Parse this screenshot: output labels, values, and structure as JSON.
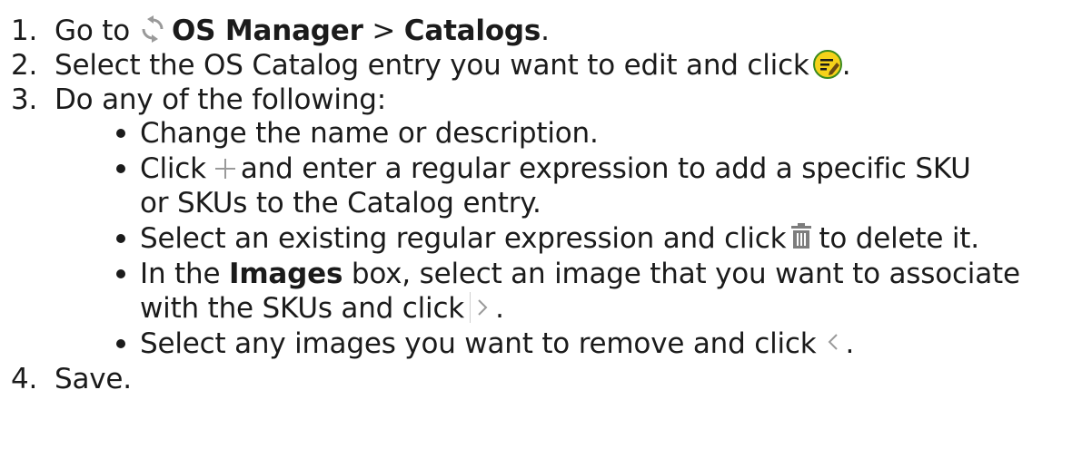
{
  "steps": [
    {
      "num": "1.",
      "pre": "Go to",
      "bold1": "OS Manager",
      "mid": ">",
      "bold2": "Catalogs",
      "end": "."
    },
    {
      "num": "2.",
      "text": "Select the OS Catalog entry you want to edit and click",
      "end": "."
    },
    {
      "num": "3.",
      "text": "Do any of the following:"
    },
    {
      "num": "4.",
      "text": "Save."
    }
  ],
  "bullets": [
    {
      "text": "Change the name or description."
    },
    {
      "pre": "Click",
      "post": "and enter a regular expression to add a specific SKU",
      "cont": "or SKUs to the Catalog entry."
    },
    {
      "pre": "Select an existing regular expression and click",
      "post": "to delete it."
    },
    {
      "pre": "In the",
      "bold": "Images",
      "post": "box, select an image that you want to associate",
      "cont_pre": "with the SKUs and click",
      "cont_end": "."
    },
    {
      "pre": "Select any images you want to remove and click",
      "end": "."
    }
  ],
  "icons": {
    "sync": "sync-icon",
    "edit": "edit-icon",
    "plus": "plus-icon",
    "trash": "trash-icon",
    "move_right": "chevron-right-icon",
    "move_left": "chevron-left-icon"
  },
  "colors": {
    "text": "#1b1b1b",
    "edit_icon_bg": "#f5d21a",
    "edit_icon_ring": "#3a8a1e",
    "icon_gray": "#9a9a9a",
    "trash_gray": "#7d7d7d"
  }
}
